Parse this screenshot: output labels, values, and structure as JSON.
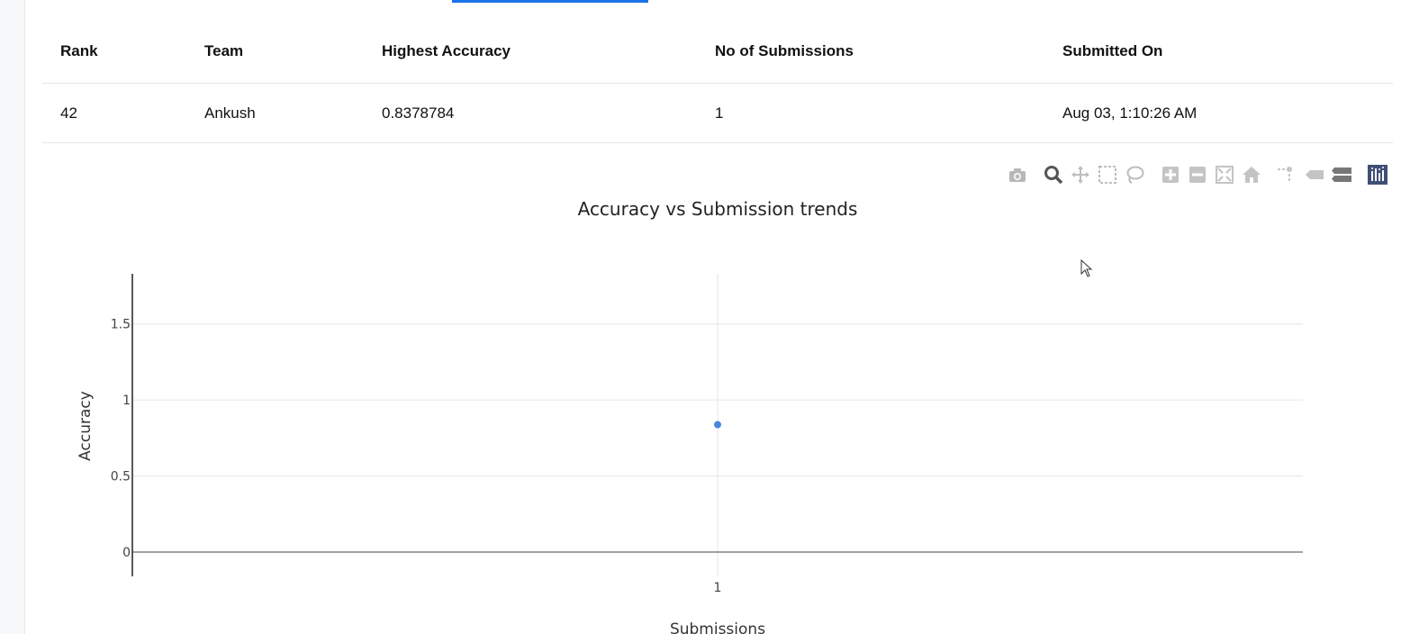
{
  "table": {
    "headers": [
      "Rank",
      "Team",
      "Highest Accuracy",
      "No of Submissions",
      "Submitted On"
    ],
    "rows": [
      [
        "42",
        "Ankush",
        "0.8378784",
        "1",
        "Aug 03, 1:10:26 AM"
      ]
    ]
  },
  "modebar": {
    "icons": [
      "camera-icon",
      "zoom-icon",
      "pan-icon",
      "box-select-icon",
      "lasso-select-icon",
      "zoom-in-icon",
      "zoom-out-icon",
      "autoscale-icon",
      "reset-axes-icon",
      "spike-lines-icon",
      "hover-closest-icon",
      "hover-compare-icon",
      "plotly-logo-icon"
    ]
  },
  "colors": {
    "accent": "#1a73e8",
    "marker": "#4a86e0",
    "plotly_logo": "#3f4f75"
  },
  "chart_data": {
    "type": "scatter",
    "title": "Accuracy vs Submission trends",
    "xlabel": "Submissions",
    "ylabel": "Accuracy",
    "x": [
      1
    ],
    "y": [
      0.8378784
    ],
    "xticks": [
      "1"
    ],
    "yticks": [
      "0",
      "0.5",
      "1",
      "1.5"
    ],
    "ytick_values": [
      0,
      0.5,
      1,
      1.5
    ],
    "ylim": [
      -0.16,
      1.83
    ],
    "grid": true,
    "marker_color": "#4a86e0"
  }
}
